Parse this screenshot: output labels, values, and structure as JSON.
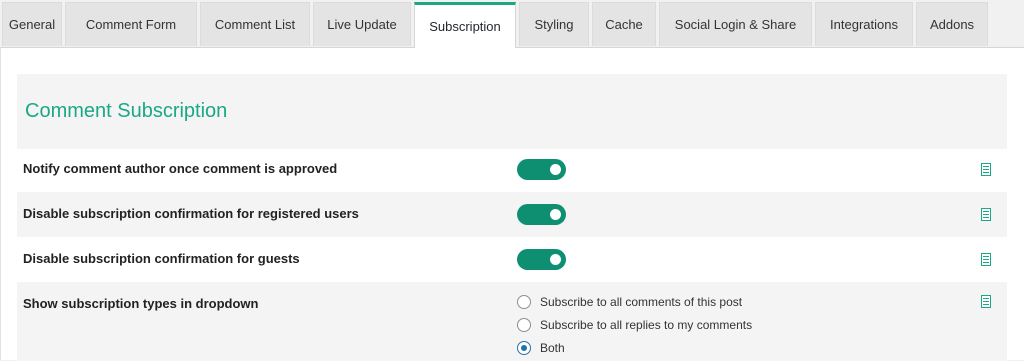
{
  "tabs": [
    {
      "label": "General",
      "active": false
    },
    {
      "label": "Comment Form",
      "active": false
    },
    {
      "label": "Comment List",
      "active": false
    },
    {
      "label": "Live Update",
      "active": false
    },
    {
      "label": "Subscription",
      "active": true
    },
    {
      "label": "Styling",
      "active": false
    },
    {
      "label": "Cache",
      "active": false
    },
    {
      "label": "Social Login & Share",
      "active": false
    },
    {
      "label": "Integrations",
      "active": false
    },
    {
      "label": "Addons",
      "active": false
    }
  ],
  "section": {
    "title": "Comment Subscription"
  },
  "settings": [
    {
      "label": "Notify comment author once comment is approved",
      "type": "toggle",
      "value": true,
      "icon": "doc-icon"
    },
    {
      "label": "Disable subscription confirmation for registered users",
      "type": "toggle",
      "value": true,
      "icon": "doc-icon"
    },
    {
      "label": "Disable subscription confirmation for guests",
      "type": "toggle",
      "value": true,
      "icon": "doc-icon"
    },
    {
      "label": "Show subscription types in dropdown",
      "type": "radio",
      "icon": "doc-icon",
      "options": [
        {
          "label": "Subscribe to all comments of this post",
          "checked": false
        },
        {
          "label": "Subscribe to all replies to my comments",
          "checked": false
        },
        {
          "label": "Both",
          "checked": true
        }
      ]
    }
  ],
  "colors": {
    "accent": "#1aa887",
    "toggle_on": "#0f8f72",
    "radio_checked": "#2271b1"
  }
}
